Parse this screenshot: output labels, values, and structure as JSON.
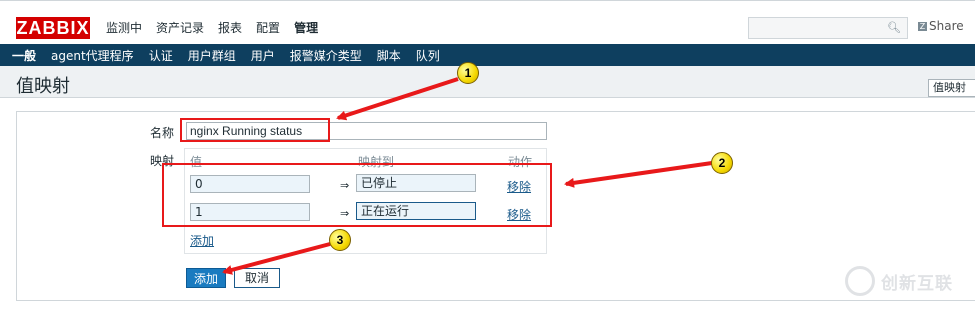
{
  "header": {
    "logo": "ZABBIX",
    "menu": [
      "监测中",
      "资产记录",
      "报表",
      "配置",
      "管理"
    ],
    "active_menu": "管理",
    "share_label": "Share",
    "share_icon": "Z"
  },
  "subnav": {
    "items": [
      "一般",
      "agent代理程序",
      "认证",
      "用户群组",
      "用户",
      "报警媒介类型",
      "脚本",
      "队列"
    ]
  },
  "page": {
    "title": "值映射",
    "title_select": "值映射"
  },
  "form": {
    "name_label": "名称",
    "name_value": "nginx Running status",
    "mapping_label": "映射",
    "col_value": "值",
    "col_mapped": "映射到",
    "col_action": "动作",
    "arrow": "⇒",
    "rows": [
      {
        "value": "0",
        "mapped": "已停止",
        "remove": "移除"
      },
      {
        "value": "1",
        "mapped": "正在运行",
        "remove": "移除"
      }
    ],
    "add_row_link": "添加",
    "add_button": "添加",
    "cancel_button": "取消"
  },
  "annotations": {
    "badges": [
      "1",
      "2",
      "3"
    ],
    "highlight_color": "#e8191a"
  },
  "watermark": {
    "text": "创新互联"
  }
}
